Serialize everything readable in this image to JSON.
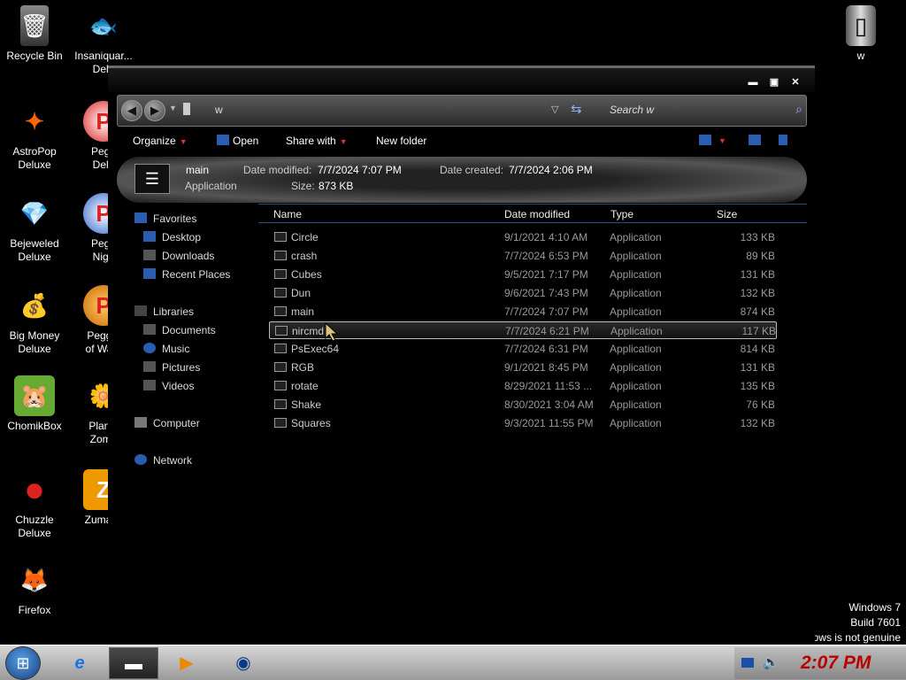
{
  "desktop": {
    "icons": [
      {
        "label": "Recycle Bin",
        "glyph": "🗑"
      },
      {
        "label": "Insaniquar...\nDelu",
        "glyph": "🐟"
      },
      {
        "label": "AstroPop\nDeluxe",
        "glyph": "✦"
      },
      {
        "label": "Pegg\nDelu",
        "glyph": "P"
      },
      {
        "label": "Bejeweled\nDeluxe",
        "glyph": "💎"
      },
      {
        "label": "Pegg\nNigh",
        "glyph": "P"
      },
      {
        "label": "Big Money\nDeluxe",
        "glyph": "💰"
      },
      {
        "label": "Peggle\nof Warc",
        "glyph": "P"
      },
      {
        "label": "ChomikBox",
        "glyph": "🐹"
      },
      {
        "label": "Plants\nZomb",
        "glyph": "🌼"
      },
      {
        "label": "Chuzzle\nDeluxe",
        "glyph": "●"
      },
      {
        "label": "Zuma D",
        "glyph": "Z"
      },
      {
        "label": "Firefox",
        "glyph": "🦊"
      },
      {
        "label": "w",
        "glyph": "▯"
      }
    ],
    "watermark": [
      "Windows 7",
      "Build 7601",
      "This copy of Windows is not genuine"
    ]
  },
  "window": {
    "controls": {
      "minimize": "▬",
      "maximize": "▣",
      "close": "✕"
    },
    "address": {
      "path": "w",
      "dropdown": "▽",
      "refresh": "⇆"
    },
    "search": {
      "placeholder": "Search w",
      "icon": "⌕"
    },
    "toolbar": {
      "organize": "Organize",
      "open": "Open",
      "share_with": "Share with",
      "new_folder": "New folder"
    },
    "details": {
      "name": "main",
      "type": "Application",
      "date_modified_label": "Date modified:",
      "date_modified": "7/7/2024 7:07 PM",
      "date_created_label": "Date created:",
      "date_created": "7/7/2024 2:06 PM",
      "size_label": "Size:",
      "size": "873 KB"
    },
    "nav": {
      "favorites": "Favorites",
      "desktop": "Desktop",
      "downloads": "Downloads",
      "recent_places": "Recent Places",
      "libraries": "Libraries",
      "documents": "Documents",
      "music": "Music",
      "pictures": "Pictures",
      "videos": "Videos",
      "computer": "Computer",
      "network": "Network"
    },
    "columns": {
      "name": "Name",
      "date_modified": "Date modified",
      "type": "Type",
      "size": "Size"
    },
    "files": [
      {
        "name": "Circle",
        "date": "9/1/2021 4:10 AM",
        "type": "Application",
        "size": "133 KB"
      },
      {
        "name": "crash",
        "date": "7/7/2024 6:53 PM",
        "type": "Application",
        "size": "89 KB"
      },
      {
        "name": "Cubes",
        "date": "9/5/2021 7:17 PM",
        "type": "Application",
        "size": "131 KB"
      },
      {
        "name": "Dun",
        "date": "9/6/2021 7:43 PM",
        "type": "Application",
        "size": "132 KB"
      },
      {
        "name": "main",
        "date": "7/7/2024 7:07 PM",
        "type": "Application",
        "size": "874 KB"
      },
      {
        "name": "nircmd",
        "date": "7/7/2024 6:21 PM",
        "type": "Application",
        "size": "117 KB"
      },
      {
        "name": "PsExec64",
        "date": "7/7/2024 6:31 PM",
        "type": "Application",
        "size": "814 KB"
      },
      {
        "name": "RGB",
        "date": "9/1/2021 8:45 PM",
        "type": "Application",
        "size": "131 KB"
      },
      {
        "name": "rotate",
        "date": "8/29/2021 11:53 ...",
        "type": "Application",
        "size": "135 KB"
      },
      {
        "name": "Shake",
        "date": "8/30/2021 3:04 AM",
        "type": "Application",
        "size": "76 KB"
      },
      {
        "name": "Squares",
        "date": "9/3/2021 11:55 PM",
        "type": "Application",
        "size": "132 KB"
      }
    ]
  },
  "taskbar": {
    "start": "⊞",
    "buttons": [
      "e",
      "▬",
      "▶",
      "◉"
    ],
    "clock": "2:07 PM"
  }
}
